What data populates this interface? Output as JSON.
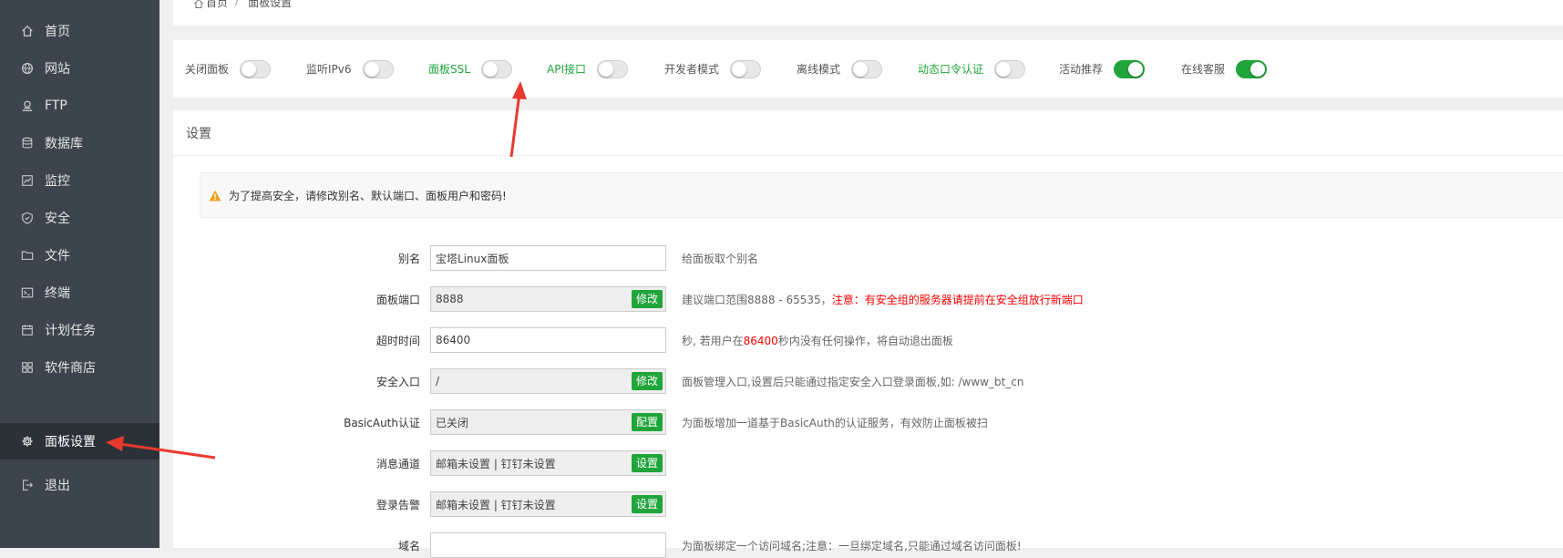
{
  "sidebar": {
    "items": [
      {
        "label": "首页",
        "icon": "home-icon"
      },
      {
        "label": "网站",
        "icon": "globe-icon"
      },
      {
        "label": "FTP",
        "icon": "ftp-icon"
      },
      {
        "label": "数据库",
        "icon": "database-icon"
      },
      {
        "label": "监控",
        "icon": "monitor-icon"
      },
      {
        "label": "安全",
        "icon": "shield-icon"
      },
      {
        "label": "文件",
        "icon": "folder-icon"
      },
      {
        "label": "终端",
        "icon": "terminal-icon"
      },
      {
        "label": "计划任务",
        "icon": "calendar-icon"
      },
      {
        "label": "软件商店",
        "icon": "apps-icon"
      },
      {
        "label": "面板设置",
        "icon": "gear-icon"
      },
      {
        "label": "退出",
        "icon": "logout-icon"
      }
    ],
    "active_index": 10
  },
  "breadcrumb": {
    "home": "首页",
    "separator": "/",
    "current": "面板设置"
  },
  "toggles": [
    {
      "label": "关闭面板",
      "on": false,
      "highlight": false
    },
    {
      "label": "监听IPv6",
      "on": false,
      "highlight": false
    },
    {
      "label": "面板SSL",
      "on": false,
      "highlight": true
    },
    {
      "label": "API接口",
      "on": false,
      "highlight": true
    },
    {
      "label": "开发者模式",
      "on": false,
      "highlight": false
    },
    {
      "label": "离线模式",
      "on": false,
      "highlight": false
    },
    {
      "label": "动态口令认证",
      "on": false,
      "highlight": true
    },
    {
      "label": "活动推荐",
      "on": true,
      "highlight": false
    },
    {
      "label": "在线客服",
      "on": true,
      "highlight": false
    }
  ],
  "settings": {
    "title": "设置",
    "alert": "为了提高安全，请修改别名、默认端口、面板用户和密码!",
    "rows": [
      {
        "label": "别名",
        "value": "宝塔Linux面板",
        "readonly": false,
        "button": "",
        "help": "给面板取个别名"
      },
      {
        "label": "面板端口",
        "value": "8888",
        "readonly": true,
        "button": "修改",
        "help": "建议端口范围8888 - 65535，",
        "help_red": "注意：有安全组的服务器请提前在安全组放行新端口"
      },
      {
        "label": "超时时间",
        "value": "86400",
        "readonly": false,
        "button": "",
        "help": "秒, 若用户在",
        "help_red": "86400",
        "help_after": "秒内没有任何操作，将自动退出面板"
      },
      {
        "label": "安全入口",
        "value": "/",
        "readonly": true,
        "button": "修改",
        "help": "面板管理入口,设置后只能通过指定安全入口登录面板,如: /www_bt_cn"
      },
      {
        "label": "BasicAuth认证",
        "value": "已关闭",
        "readonly": true,
        "button": "配置",
        "help": "为面板增加一道基于BasicAuth的认证服务，有效防止面板被扫"
      },
      {
        "label": "消息通道",
        "value": "邮箱未设置 | 钉钉未设置",
        "readonly": true,
        "button": "设置",
        "help": ""
      },
      {
        "label": "登录告警",
        "value": "邮箱未设置 | 钉钉未设置",
        "readonly": true,
        "button": "设置",
        "help": ""
      },
      {
        "label": "域名",
        "value": "",
        "readonly": false,
        "button": "",
        "help": "为面板绑定一个访问域名;注意：一旦绑定域名,只能通过域名访问面板!"
      }
    ]
  },
  "colors": {
    "sidebar_bg": "#3c444d",
    "accent": "#20a53a",
    "annotation": "#e8392f"
  }
}
